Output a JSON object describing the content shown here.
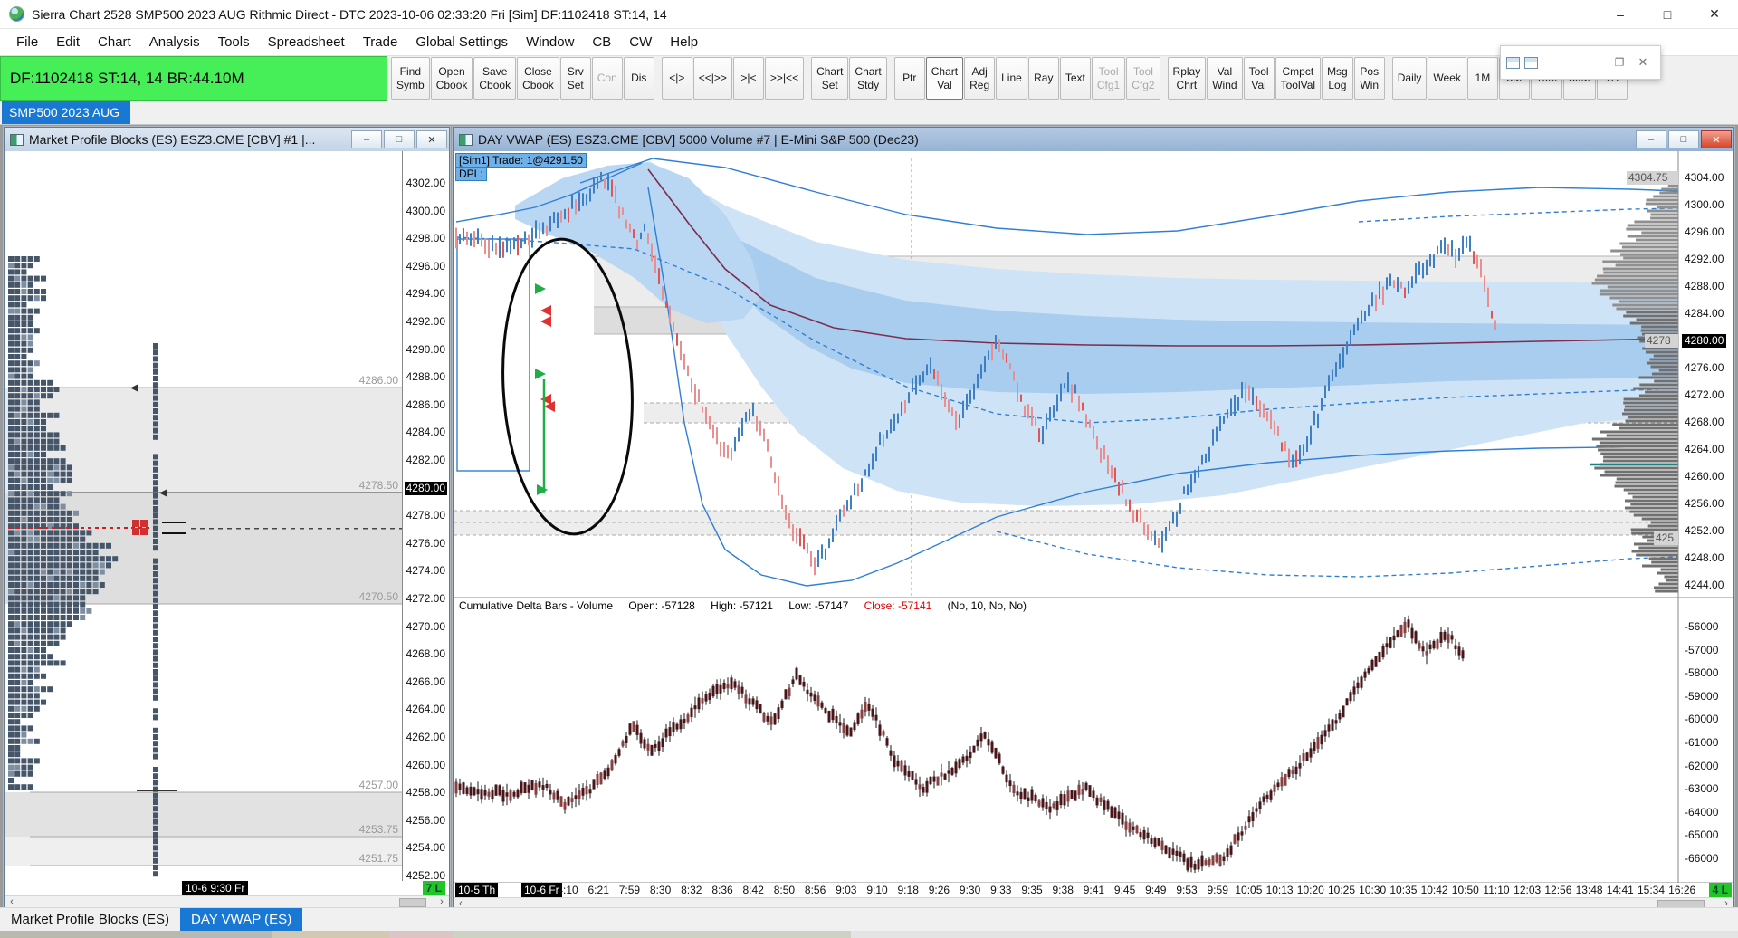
{
  "titlebar": {
    "title": "Sierra Chart 2528 SMP500 2023 AUG Rithmic Direct - DTC 2023-10-06  02:33:20 Fri [Sim]  DF:1102418  ST:14, 14",
    "controls": {
      "minimize": "–",
      "maximize": "□",
      "close": "✕"
    }
  },
  "menu": {
    "items": [
      "File",
      "Edit",
      "Chart",
      "Analysis",
      "Tools",
      "Spreadsheet",
      "Trade",
      "Global Settings",
      "Window",
      "CB",
      "CW",
      "Help"
    ]
  },
  "toolbar": {
    "status": "DF:1102418  ST:14, 14  BR:44.10M",
    "buttons": [
      {
        "label": "Find\nSymb"
      },
      {
        "label": "Open\nCbook"
      },
      {
        "label": "Save\nCbook"
      },
      {
        "label": "Close\nCbook"
      },
      {
        "label": "Srv\nSet"
      },
      {
        "label": "Con",
        "state": "disabled"
      },
      {
        "label": "Dis"
      },
      {
        "label": "<|>",
        "gap": true
      },
      {
        "label": "<<|>>"
      },
      {
        "label": ">|<"
      },
      {
        "label": ">>|<<"
      },
      {
        "label": "Chart\nSet",
        "gap": true
      },
      {
        "label": "Chart\nStdy"
      },
      {
        "label": "Ptr",
        "gap": true
      },
      {
        "label": "Chart\nVal",
        "state": "active"
      },
      {
        "label": "Adj\nReg"
      },
      {
        "label": "Line"
      },
      {
        "label": "Ray"
      },
      {
        "label": "Text"
      },
      {
        "label": "Tool\nCfg1",
        "state": "disabled"
      },
      {
        "label": "Tool\nCfg2",
        "state": "disabled"
      },
      {
        "label": "Rplay\nChrt",
        "gap": true
      },
      {
        "label": "Val\nWind"
      },
      {
        "label": "Tool\nVal"
      },
      {
        "label": "Cmpct\nToolVal"
      },
      {
        "label": "Msg\nLog"
      },
      {
        "label": "Pos\nWin"
      },
      {
        "label": "Daily",
        "gap": true
      },
      {
        "label": "Week"
      },
      {
        "label": "1M"
      },
      {
        "label": "5M"
      },
      {
        "label": "10M"
      },
      {
        "label": "30M"
      },
      {
        "label": "1H"
      }
    ]
  },
  "tabbar": {
    "tabs": [
      {
        "label": "SMP500 2023 AUG",
        "active": true
      }
    ]
  },
  "left_window": {
    "title": "Market Profile Blocks (ES) ESZ3.CME [CBV] #1 |...",
    "price_scale": {
      "labels": [
        "4302.00",
        "4300.00",
        "4298.00",
        "4296.00",
        "4294.00",
        "4292.00",
        "4290.00",
        "4288.00",
        "4286.00",
        "4284.00",
        "4282.00",
        "4280.00",
        "4278.00",
        "4276.00",
        "4274.00",
        "4272.00",
        "4270.00",
        "4268.00",
        "4266.00",
        "4264.00",
        "4262.00",
        "4260.00",
        "4258.00",
        "4256.00",
        "4254.00",
        "4252.00"
      ],
      "highlight": "4280.00"
    },
    "level_labels": [
      "4286.00",
      "4278.50",
      "4270.50",
      "4257.00",
      "4253.75",
      "4251.75"
    ],
    "time_label": "10-6  9:30 Fr",
    "count_badge": "7 L"
  },
  "right_window": {
    "title": "DAY VWAP (ES) ESZ3.CME [CBV]  5000 Volume #7 | E-Mini S&P 500 (Dec23)",
    "trade_overlay": {
      "line1": "[Sim1]  Trade: 1@4291.50",
      "line2": "DPL:"
    },
    "price_axis": {
      "labels": [
        "4304.00",
        "4300.00",
        "4296.00",
        "4292.00",
        "4288.00",
        "4284.00",
        "4280.00",
        "4276.00",
        "4272.00",
        "4268.00",
        "4264.00",
        "4260.00",
        "4256.00",
        "4252.00",
        "4248.00",
        "4244.00"
      ],
      "highlight": "4280.00"
    },
    "study_labels": {
      "top": "4304.75",
      "mid": "4278",
      "low": "425"
    },
    "delta_header": {
      "name": "Cumulative Delta Bars - Volume",
      "open_label": "Open: -57128",
      "high_label": "High: -57121",
      "low_label": "Low: -57147",
      "close_label": "Close: -57141",
      "params": "(No, 10, No, No)"
    },
    "delta_axis": [
      "-56000",
      "-57000",
      "-58000",
      "-59000",
      "-60000",
      "-61000",
      "-62000",
      "-63000",
      "-64000",
      "-65000",
      "-66000"
    ],
    "time_axis": {
      "days": [
        "10-5 Th",
        "10-6 Fr"
      ],
      "times": [
        "4:10",
        "6:21",
        "7:59",
        "8:30",
        "8:32",
        "8:36",
        "8:42",
        "8:50",
        "8:56",
        "9:03",
        "9:10",
        "9:18",
        "9:26",
        "9:30",
        "9:33",
        "9:35",
        "9:38",
        "9:41",
        "9:45",
        "9:49",
        "9:53",
        "9:59",
        "10:05",
        "10:13",
        "10:20",
        "10:25",
        "10:30",
        "10:35",
        "10:42",
        "10:50",
        "11:10",
        "12:03",
        "12:56",
        "13:48",
        "14:41",
        "15:34",
        "16:26"
      ]
    },
    "count_badge": "4 L"
  },
  "taskbar": {
    "items": [
      {
        "label": "Market Profile Blocks (ES)",
        "active": false
      },
      {
        "label": "DAY VWAP (ES)",
        "active": true
      }
    ]
  }
}
